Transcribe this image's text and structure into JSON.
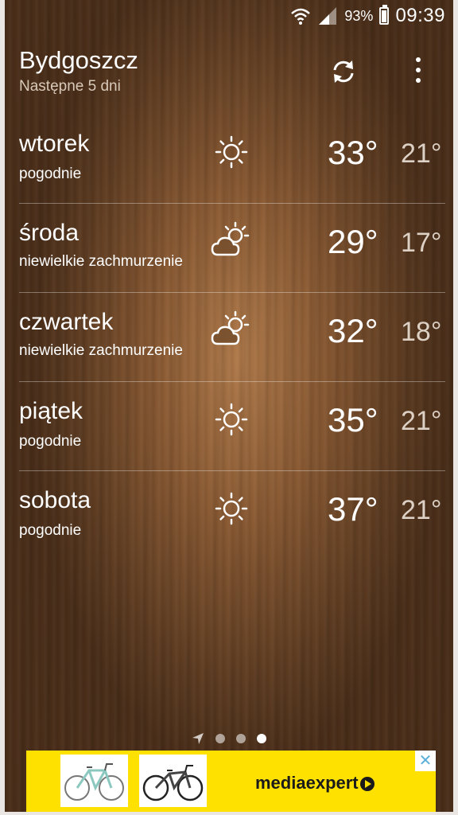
{
  "status_bar": {
    "battery": "93%",
    "time": "09:39"
  },
  "header": {
    "city": "Bydgoszcz",
    "subtitle": "Następne 5 dni"
  },
  "forecast": [
    {
      "day": "wtorek",
      "description": "pogodnie",
      "icon": "sun-icon",
      "high": "33°",
      "low": "21°"
    },
    {
      "day": "środa",
      "description": "niewielkie zachmurzenie",
      "icon": "partly-cloudy-icon",
      "high": "29°",
      "low": "17°"
    },
    {
      "day": "czwartek",
      "description": "niewielkie zachmurzenie",
      "icon": "partly-cloudy-icon",
      "high": "32°",
      "low": "18°"
    },
    {
      "day": "piątek",
      "description": "pogodnie",
      "icon": "sun-icon",
      "high": "35°",
      "low": "21°"
    },
    {
      "day": "sobota",
      "description": "pogodnie",
      "icon": "sun-icon",
      "high": "37°",
      "low": "21°"
    }
  ],
  "pager": {
    "pages": 3,
    "active_page": 3
  },
  "ad": {
    "brand_part1": "media",
    "brand_part2": "expert",
    "close": "✕"
  }
}
